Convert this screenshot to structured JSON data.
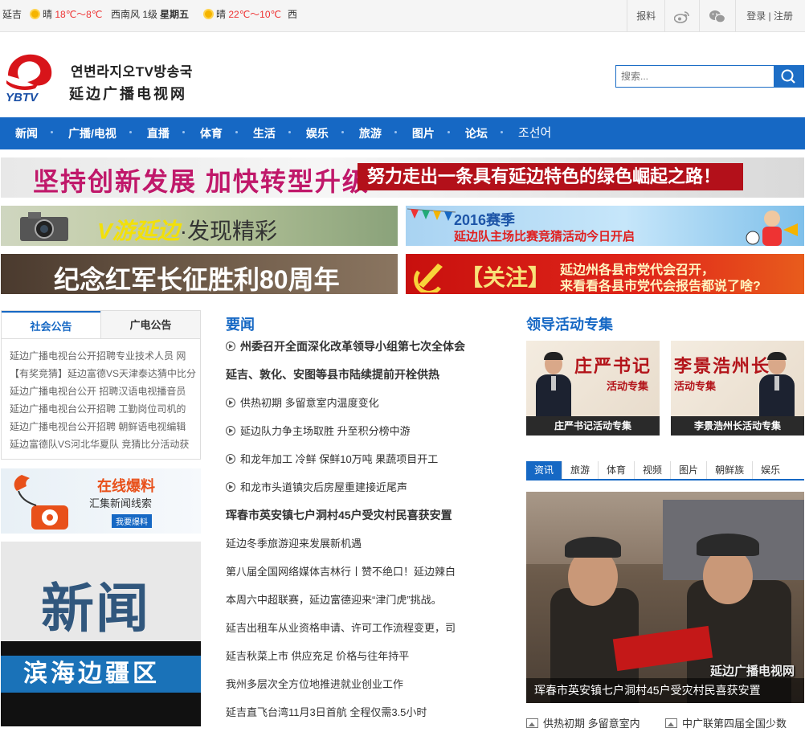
{
  "weather": {
    "city": "延吉",
    "today_desc": "晴",
    "today_temp": "18℃～8℃",
    "wind": "西南风 1级",
    "weekday": "星期五",
    "tomorrow_desc": "晴",
    "tomorrow_temp": "22℃～10℃",
    "tomorrow_wind": "西"
  },
  "top_links": {
    "report": "报料",
    "login": "登录 | 注册"
  },
  "brand": {
    "logo_text": "YBTV",
    "korean_name": "연변라지오TV방송국",
    "chinese_name": "延边广播电视网"
  },
  "search": {
    "placeholder": "搜索..."
  },
  "nav": [
    "新闻",
    "广播/电视",
    "直播",
    "体育",
    "生活",
    "娱乐",
    "旅游",
    "图片",
    "论坛",
    "조선어"
  ],
  "banners": {
    "b1_left": "坚持创新发展 加快转型升级",
    "b1_right": "努力走出一条具有延边特色的绿色崛起之路！",
    "b2_script": "V游延边",
    "b2_text": "·发现精彩",
    "b3_title": "2016赛季",
    "b3_sub": "延边队主场比赛竞猜活动今日开启",
    "b4": "纪念红军长征胜利80周年",
    "b5_tag": "【关注】",
    "b5_line1": "延边州各县市党代会召开，",
    "b5_line2": "来看看各县市党代会报告都说了啥?"
  },
  "notice": {
    "tab_social": "社会公告",
    "tab_broadcast": "广电公告",
    "items": [
      "延边广播电视台公开招聘专业技术人员 网",
      "【有奖竞猜】延边富德VS天津泰达猜中比分",
      "延边广播电视台公开 招聘汉语电视播音员",
      "延边广播电视台公开招聘 工勤岗位司机的",
      "延边广播电视台公开招聘 朝鲜语电视编辑",
      "延边富德队VS河北华夏队 竞猜比分活动获"
    ]
  },
  "tip_ad": {
    "title": "在线爆料",
    "sub": "汇集新闻线索",
    "btn": "我要爆料"
  },
  "news_ad": {
    "big": "新闻",
    "blue": "滨海边疆区"
  },
  "headlines": {
    "title": "要闻",
    "items": [
      {
        "text": "州委召开全面深化改革领导小组第七次全体会",
        "bold": true,
        "video": true
      },
      {
        "text": "延吉、敦化、安图等县市陆续提前开栓供热",
        "bold": true,
        "video": false
      },
      {
        "text": "供热初期 多留意室内温度变化",
        "bold": false,
        "video": true
      },
      {
        "text": "延边队力争主场取胜 升至积分榜中游",
        "bold": false,
        "video": true
      },
      {
        "text": "和龙年加工 冷鲜 保鲜10万吨 果蔬项目开工",
        "bold": false,
        "video": true
      },
      {
        "text": "和龙市头道镇灾后房屋重建接近尾声",
        "bold": false,
        "video": true
      },
      {
        "text": "珲春市英安镇七户洞村45户受灾村民喜获安置",
        "bold": true,
        "video": false
      },
      {
        "text": "延边冬季旅游迎来发展新机遇",
        "bold": false,
        "video": false
      },
      {
        "text": "第八届全国网络媒体吉林行丨赞不绝口！延边辣白",
        "bold": false,
        "video": false
      },
      {
        "text": "本周六中超联赛，延边富德迎来“津门虎”挑战。",
        "bold": false,
        "video": false
      },
      {
        "text": "延吉出租车从业资格申请、许可工作流程变更，司",
        "bold": false,
        "video": false
      },
      {
        "text": "延吉秋菜上市 供应充足 价格与往年持平",
        "bold": false,
        "video": false
      },
      {
        "text": "我州多层次全方位地推进就业创业工作",
        "bold": false,
        "video": false
      },
      {
        "text": "延吉直飞台湾11月3日首航 全程仅需3.5小时",
        "bold": false,
        "video": false
      }
    ]
  },
  "leaders": {
    "title": "领导活动专集",
    "items": [
      {
        "calligraphy": "庄严书记",
        "sub": "活动专集",
        "caption": "庄严书记活动专集"
      },
      {
        "calligraphy": "李景浩州长",
        "sub": "活动专集",
        "caption": "李景浩州长活动专集"
      }
    ]
  },
  "media_tabs": [
    "资讯",
    "旅游",
    "体育",
    "视频",
    "图片",
    "朝鲜族",
    "娱乐"
  ],
  "photo": {
    "watermark": "延边广播电视网",
    "caption": "珲春市英安镇七户洞村45户受灾村民喜获安置"
  },
  "bottom_links": [
    "供热初期 多留意室内",
    "中广联第四届全国少数"
  ],
  "colors": {
    "brand_blue": "#1668c4",
    "accent_red": "#e33333"
  }
}
